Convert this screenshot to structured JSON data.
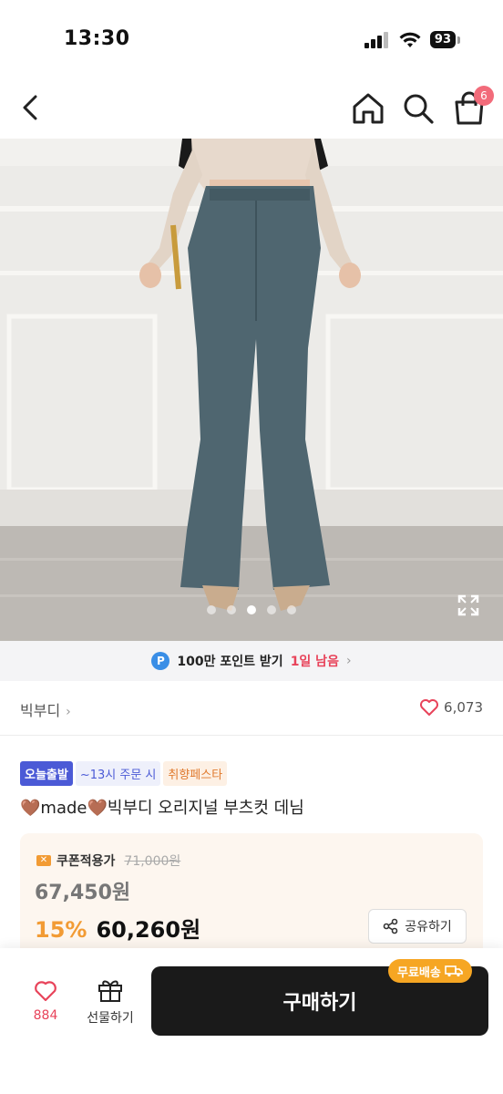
{
  "status_bar": {
    "time": "13:30",
    "battery": "93"
  },
  "nav": {
    "cart_count": "6"
  },
  "gallery": {
    "dots": 5,
    "active_dot_index": 2
  },
  "points_banner": {
    "badge": "P",
    "text": "100만 포인트 받기",
    "highlight": "1일 남음",
    "chevron": "›"
  },
  "brand": {
    "name": "빅부디",
    "chevron": "›"
  },
  "likes": {
    "count": "6,073"
  },
  "tags": [
    "오늘출발",
    "~13시 주문 시",
    "취향페스타"
  ],
  "product": {
    "title": "🤎made🤎빅부디 오리지널 부츠컷 데님"
  },
  "price": {
    "coupon_icon": "✕",
    "coupon_label": "쿠폰적용가",
    "original": "71,000원",
    "coupon_price": "67,450원",
    "discount": "15%",
    "final": "60,260원"
  },
  "share": {
    "label": "공유하기"
  },
  "bottom": {
    "wish_count": "884",
    "gift_label": "선물하기",
    "buy_label": "구매하기",
    "free_shipping": "무료배송"
  },
  "colors": {
    "accent_red": "#e8435a",
    "accent_orange": "#f29b34",
    "blue_tag": "#4b5ad6",
    "buy_button": "#1a1a1a"
  }
}
